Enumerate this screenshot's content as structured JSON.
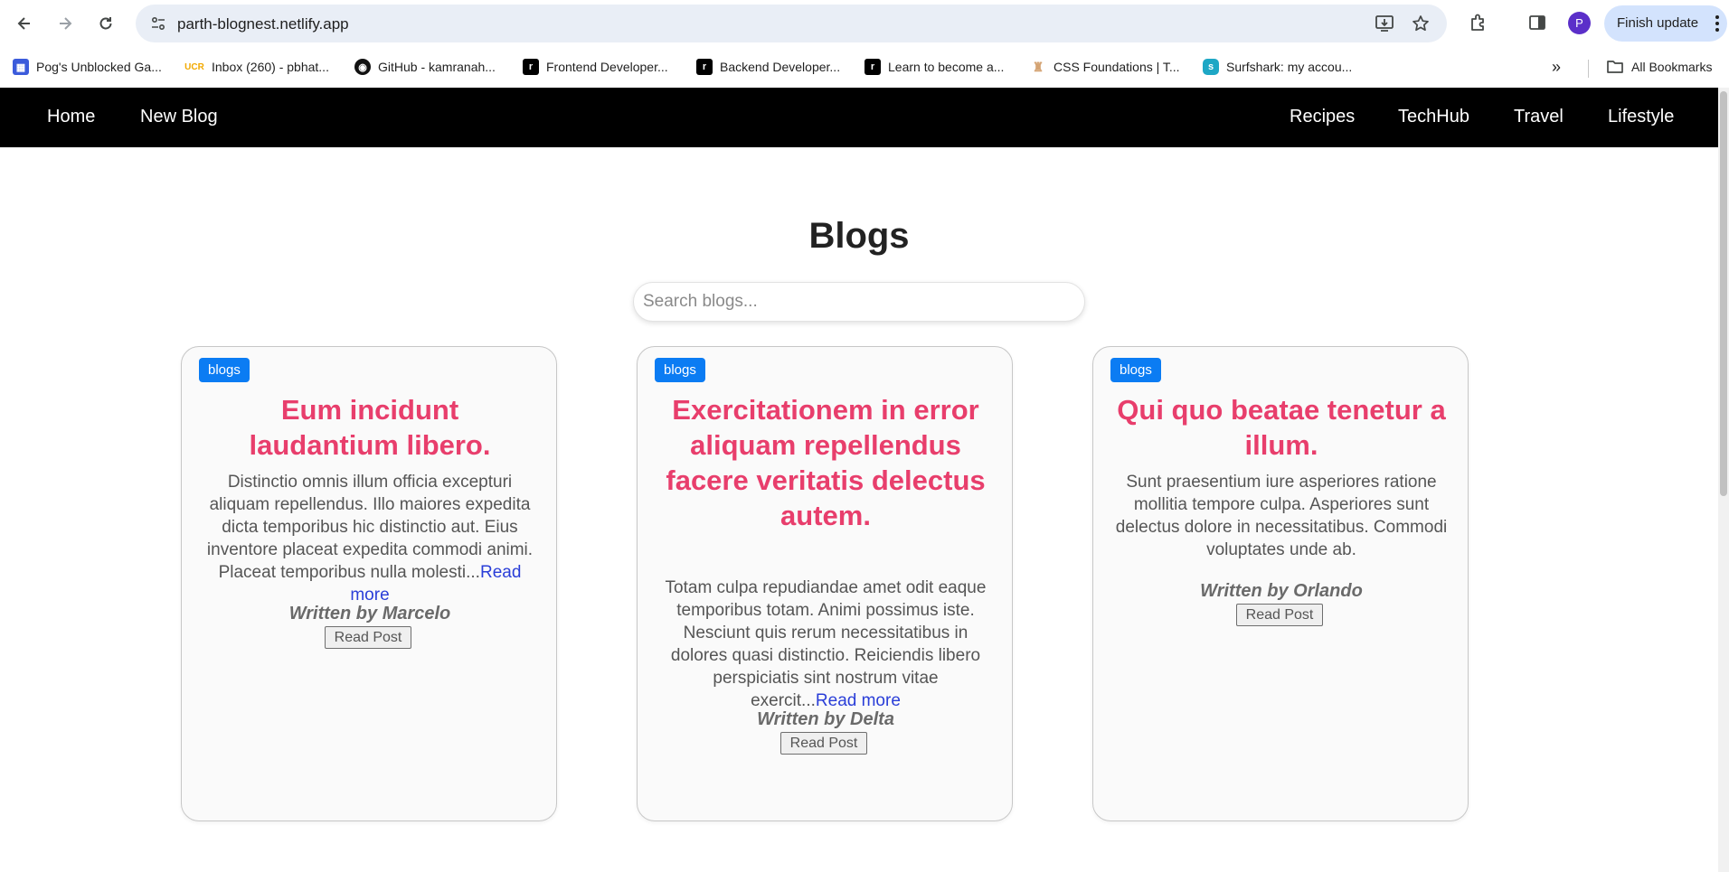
{
  "browser": {
    "url": "parth-blognest.netlify.app",
    "finish_update_label": "Finish update",
    "profile_initial": "P",
    "all_bookmarks_label": "All Bookmarks",
    "bookmarks": [
      {
        "label": "Pog's Unblocked Ga...",
        "icon": "grid-icon",
        "color": "#3b5bdb"
      },
      {
        "label": "Inbox (260) - pbhat...",
        "icon": "ucr-icon",
        "color": "#f2a900"
      },
      {
        "label": "GitHub - kamranah...",
        "icon": "github-icon",
        "color": "#111111"
      },
      {
        "label": "Frontend Developer...",
        "icon": "roadmap-icon",
        "color": "#000000"
      },
      {
        "label": "Backend Developer...",
        "icon": "roadmap-icon",
        "color": "#000000"
      },
      {
        "label": "Learn to become a...",
        "icon": "roadmap-icon",
        "color": "#000000"
      },
      {
        "label": "CSS Foundations | T...",
        "icon": "odin-icon",
        "color": "#d4a373"
      },
      {
        "label": "Surfshark: my accou...",
        "icon": "surfshark-icon",
        "color": "#1ea7c5"
      }
    ]
  },
  "site_nav": {
    "left": [
      "Home",
      "New Blog"
    ],
    "right": [
      "Recipes",
      "TechHub",
      "Travel",
      "Lifestyle"
    ]
  },
  "main": {
    "title": "Blogs",
    "search_placeholder": "Search blogs..."
  },
  "cards": [
    {
      "badge": "blogs",
      "title": "Eum incidunt laudantium libero.",
      "body": "Distinctio omnis illum officia excepturi aliquam repellendus. Illo maiores expedita dicta temporibus hic distinctio aut. Eius inventore placeat expedita commodi animi. Placeat temporibus nulla molesti...",
      "read_more": "Read more",
      "author": "Written by Marcelo",
      "button": "Read Post"
    },
    {
      "badge": "blogs",
      "title": "Exercitationem in error aliquam repellendus facere veritatis delectus autem.",
      "body": "Totam culpa repudiandae amet odit eaque temporibus totam. Animi possimus iste. Nesciunt quis rerum necessitatibus in dolores quasi distinctio. Reiciendis libero perspiciatis sint nostrum vitae exercit...",
      "read_more": "Read more",
      "author": "Written by Delta",
      "button": "Read Post"
    },
    {
      "badge": "blogs",
      "title": "Qui quo beatae tenetur a illum.",
      "body": "Sunt praesentium iure asperiores ratione mollitia tempore culpa. Asperiores sunt delectus dolore in necessitatibus. Commodi voluptates unde ab.",
      "author": "Written by Orlando",
      "button": "Read Post"
    }
  ]
}
